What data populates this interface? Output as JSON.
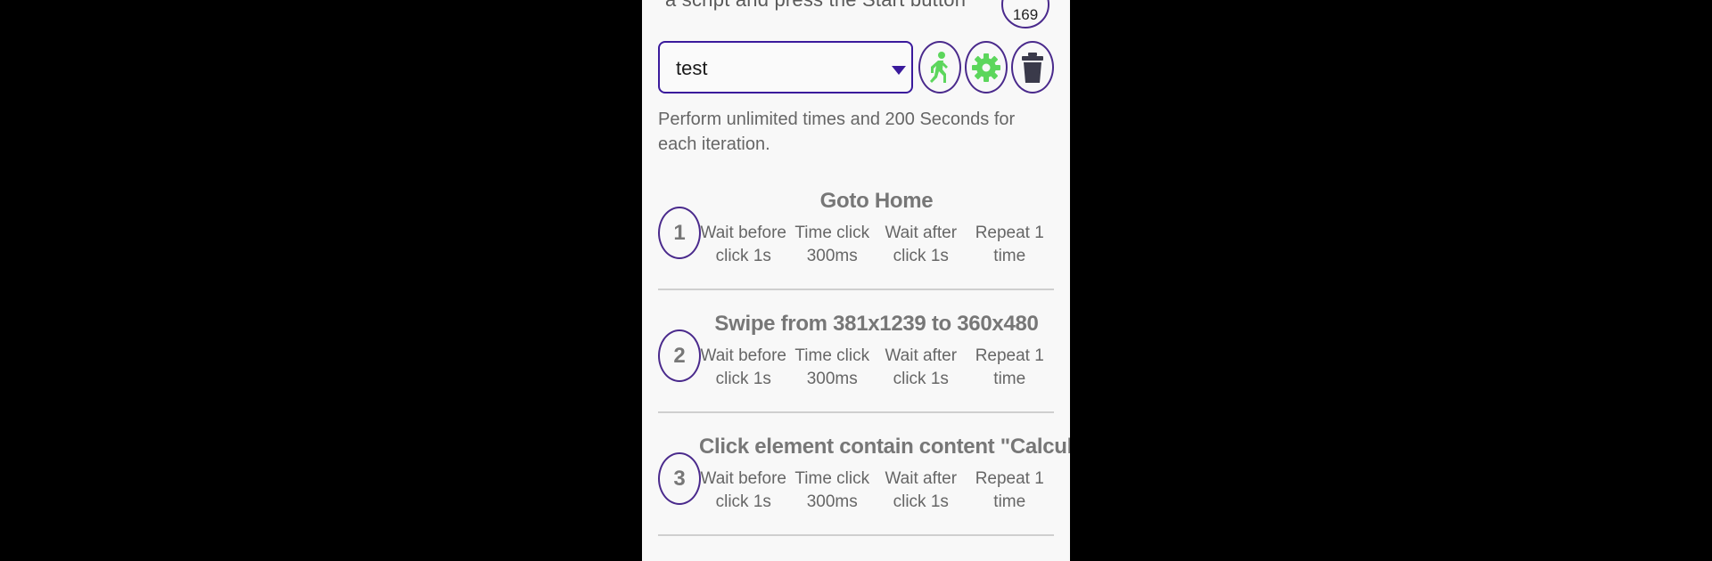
{
  "header": {
    "instruction_text": "a script and press the Start button",
    "counter": "169"
  },
  "script_selector": {
    "selected": "test"
  },
  "toolbar": {
    "start_icon": "running-person-icon",
    "settings_icon": "gear-icon",
    "delete_icon": "trash-icon"
  },
  "summary": "Perform unlimited times and 200 Seconds for each iteration.",
  "steps": [
    {
      "number": "1",
      "title": "Goto Home",
      "wait_before": "Wait before click 1s",
      "time_click": "Time click 300ms",
      "wait_after": "Wait after click 1s",
      "repeat": "Repeat 1 time"
    },
    {
      "number": "2",
      "title": "Swipe from 381x1239 to 360x480",
      "wait_before": "Wait before click 1s",
      "time_click": "Time click 300ms",
      "wait_after": "Wait after click 1s",
      "repeat": "Repeat 1 time"
    },
    {
      "number": "3",
      "title": "Click element contain content \"Calculator\"",
      "wait_before": "Wait before click 1s",
      "time_click": "Time click 300ms",
      "wait_after": "Wait after click 1s",
      "repeat": "Repeat 1 time"
    }
  ],
  "colors": {
    "accent": "#3a1a9c",
    "icon_green": "#5cd65c",
    "icon_dark": "#3a3a4a"
  }
}
